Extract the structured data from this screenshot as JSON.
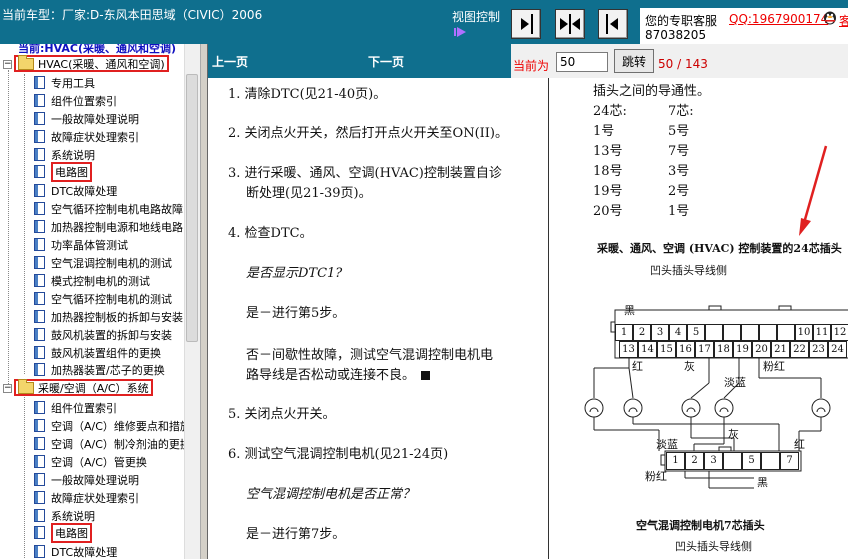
{
  "header": {
    "vehicle": "当前车型：厂家:D-东风本田思域（CIVIC）2006",
    "view_control": "视图控制",
    "service_label": "您的专职客服",
    "qq": "QQ:1967900174",
    "service_number": "87038205",
    "more": "客"
  },
  "tree": {
    "root": "当前:HVAC(采暖、通风和空调)",
    "groups": [
      {
        "label": "HVAC(采暖、通风和空调)",
        "items": [
          "专用工具",
          "组件位置索引",
          "一般故障处理说明",
          "故障症状处理索引",
          "系统说明",
          "电路图",
          "DTC故障处理",
          "空气循环控制电机电路故障",
          "加热器控制电源和地线电路",
          "功率晶体管测试",
          "空气混调控制电机的测试",
          "模式控制电机的测试",
          "空气循环控制电机的测试",
          "加热器控制板的拆卸与安装",
          "鼓风机装置的拆卸与安装",
          "鼓风机装置组件的更换",
          "加热器装置/芯子的更换"
        ]
      },
      {
        "label": "采暖/空调（A/C）系统",
        "items": [
          "组件位置索引",
          "空调（A/C）维修要点和措施",
          "空调（A/C）制冷剂油的更换",
          "空调（A/C）管更换",
          "一般故障处理说明",
          "故障症状处理索引",
          "系统说明",
          "电路图",
          "DTC故障处理"
        ]
      }
    ]
  },
  "nav": {
    "prev": "上一页",
    "next": "下一页",
    "current_label": "当前为",
    "page_value": "50",
    "jump": "跳转",
    "page_count": "50 / 143"
  },
  "doc_left": {
    "s1": "1.  清除DTC(见21-40页)。",
    "s2": "2.  关闭点火开关，然后打开点火开关至ON(II)。",
    "s3a": "3.  进行采暖、通风、空调(HVAC)控制装置自诊",
    "s3b": "断处理(见21-39页)。",
    "s4": "4.  检查DTC。",
    "q1": "是否显示DTC1?",
    "a1": "是－进行第5步。",
    "a2a": "否－间歇性故障，测试空气混调控制电机电",
    "a2b": "路导线是否松动或连接不良。",
    "s5": "5.  关闭点火开关。",
    "s6": "6.  测试空气混调控制电机(见21-24页)",
    "q2": "空气混调控制电机是否正常？",
    "a3": "是－进行第7步。"
  },
  "doc_right": {
    "intro": "插头之间的导通性。",
    "col_a": "24芯:",
    "col_b": "7芯:",
    "pairs": [
      [
        "1号",
        "5号"
      ],
      [
        "13号",
        "7号"
      ],
      [
        "18号",
        "3号"
      ],
      [
        "19号",
        "2号"
      ],
      [
        "20号",
        "1号"
      ]
    ],
    "fig1_title": "采暖、通风、空调 (HVAC) 控制装置的24芯插头",
    "fig1_sub": "凹头插头导线侧",
    "wire_black_top": "黑",
    "wire_red": "红",
    "wire_gray": "灰",
    "wire_pink_red_top": "粉红",
    "wire_light_blue_right": "淡蓝",
    "wire_light_blue_left": "淡蓝",
    "wire_gray_mid": "灰",
    "wire_red_right": "红",
    "wire_pink_red_bottom": "粉红",
    "wire_black_bottom": "黑",
    "conn24_top": [
      "1",
      "2",
      "3",
      "4",
      "5",
      "",
      "",
      "",
      "",
      "",
      "10",
      "11",
      "12"
    ],
    "conn24_bottom": [
      "13",
      "14",
      "15",
      "16",
      "17",
      "18",
      "19",
      "20",
      "21",
      "22",
      "23",
      "24"
    ],
    "conn7": [
      "1",
      "2",
      "3",
      "",
      "5",
      "",
      "7"
    ],
    "fig2_title": "空气混调控制电机7芯插头",
    "fig2_sub": "凹头插头导线侧"
  },
  "colors": {
    "header_bg": "#0f6f8e",
    "highlight": "#e02020",
    "tree_root": "#1010c0"
  }
}
